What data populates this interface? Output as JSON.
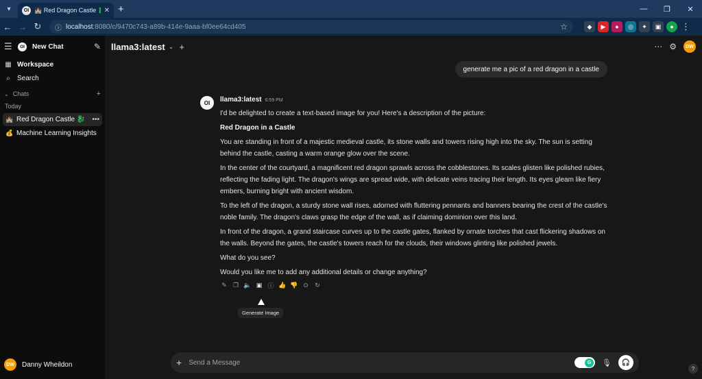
{
  "browser": {
    "tab_title": "🏰 Red Dragon Castle 🐉 | Op",
    "tab_favicon": "OI",
    "url_host": "localhost",
    "url_rest": ":8080/c/9470c743-a89b-414e-9aaa-bf0ee64cd405",
    "new_tab_icon": "+",
    "profile_avatar": "DW"
  },
  "sidebar": {
    "new_chat_label": "New Chat",
    "logo_text": "OI",
    "workspace_label": "Workspace",
    "search_label": "Search",
    "chats_section_label": "Chats",
    "today_label": "Today",
    "chats": [
      {
        "emoji": "🏰",
        "title": "Red Dragon Castle 🐉",
        "active": true
      },
      {
        "emoji": "💰",
        "title": "Machine Learning Insights",
        "active": false
      }
    ],
    "user": {
      "initials": "DW",
      "name": "Danny Wheildon"
    }
  },
  "header": {
    "model_name": "llama3:latest",
    "settings_icon": "controls-icon",
    "avatar_initials": "DW"
  },
  "conversation": {
    "user_message": "generate me a pic of a red dragon in a castle",
    "assistant": {
      "avatar": "OI",
      "name": "llama3:latest",
      "time": "6:59 PM",
      "intro": "I'd be delighted to create a text-based image for you! Here's a description of the picture:",
      "heading": "Red Dragon in a Castle",
      "paragraphs": [
        "You are standing in front of a majestic medieval castle, its stone walls and towers rising high into the sky. The sun is setting behind the castle, casting a warm orange glow over the scene.",
        "In the center of the courtyard, a magnificent red dragon sprawls across the cobblestones. Its scales glisten like polished rubies, reflecting the fading light. The dragon's wings are spread wide, with delicate veins tracing their length. Its eyes gleam like fiery embers, burning bright with ancient wisdom.",
        "To the left of the dragon, a sturdy stone wall rises, adorned with fluttering pennants and banners bearing the crest of the castle's noble family. The dragon's claws grasp the edge of the wall, as if claiming dominion over this land.",
        "In front of the dragon, a grand staircase curves up to the castle gates, flanked by ornate torches that cast flickering shadows on the walls. Beyond the gates, the castle's towers reach for the clouds, their windows glinting like polished jewels.",
        "What do you see?",
        "Would you like me to add any additional details or change anything?"
      ]
    },
    "tooltip": "Generate Image"
  },
  "composer": {
    "placeholder": "Send a Message"
  },
  "colors": {
    "sidebar_bg": "#0d0d0d",
    "main_bg": "#171717",
    "tabbar_bg": "#1e3a5f",
    "avatar": "#f59e0b"
  }
}
